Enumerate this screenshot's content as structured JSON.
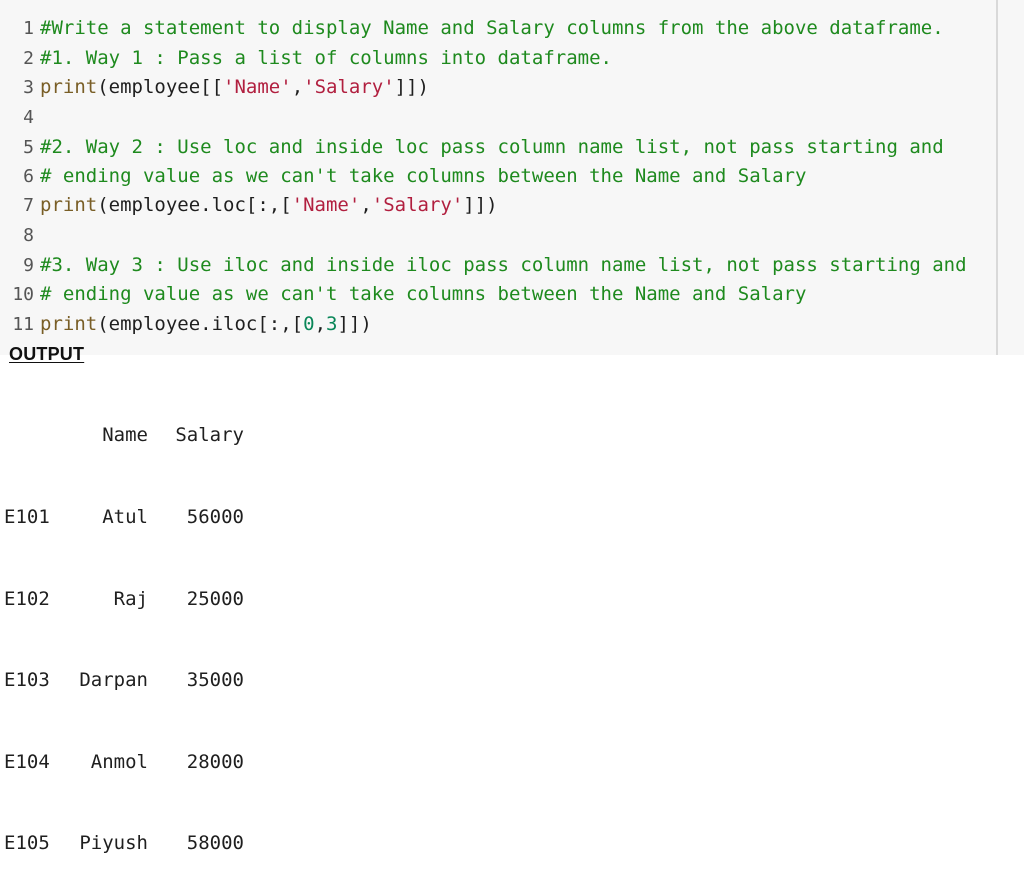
{
  "code": {
    "lines": [
      {
        "n": "1",
        "comment": "#Write a statement to display Name and Salary columns from the above dataframe."
      },
      {
        "n": "2",
        "comment": "#1. Way 1 : Pass a list of columns into dataframe."
      },
      {
        "n": "3",
        "fn": "print",
        "a": "(employee[[",
        "s1": "'Name'",
        "b": ",",
        "s2": "'Salary'",
        "c": "]])"
      },
      {
        "n": "4"
      },
      {
        "n": "5",
        "comment": "#2. Way 2 : Use loc and inside loc pass column name list, not pass starting and"
      },
      {
        "n": "6",
        "comment": "# ending value as we can't take columns between the Name and Salary"
      },
      {
        "n": "7",
        "fn": "print",
        "a": "(employee.loc[:,[",
        "s1": "'Name'",
        "b": ",",
        "s2": "'Salary'",
        "c": "]])"
      },
      {
        "n": "8"
      },
      {
        "n": "9",
        "comment": "#3. Way 3 : Use iloc and inside iloc pass column name list, not pass starting and"
      },
      {
        "n": "10",
        "comment": "# ending value as we can't take columns between the Name and Salary"
      },
      {
        "n": "11",
        "fn": "print",
        "a": "(employee.iloc[:,[",
        "num1": "0",
        "b": ",",
        "num2": "3",
        "c": "]])"
      }
    ]
  },
  "output": {
    "label": "OUTPUT",
    "header": {
      "name": "Name",
      "salary": "Salary"
    },
    "rows": [
      {
        "index": "E101",
        "name": "Atul",
        "salary": "56000"
      },
      {
        "index": "E102",
        "name": "Raj",
        "salary": "25000"
      },
      {
        "index": "E103",
        "name": "Darpan",
        "salary": "35000"
      },
      {
        "index": "E104",
        "name": "Anmol",
        "salary": "28000"
      },
      {
        "index": "E105",
        "name": "Piyush",
        "salary": "58000"
      }
    ]
  }
}
